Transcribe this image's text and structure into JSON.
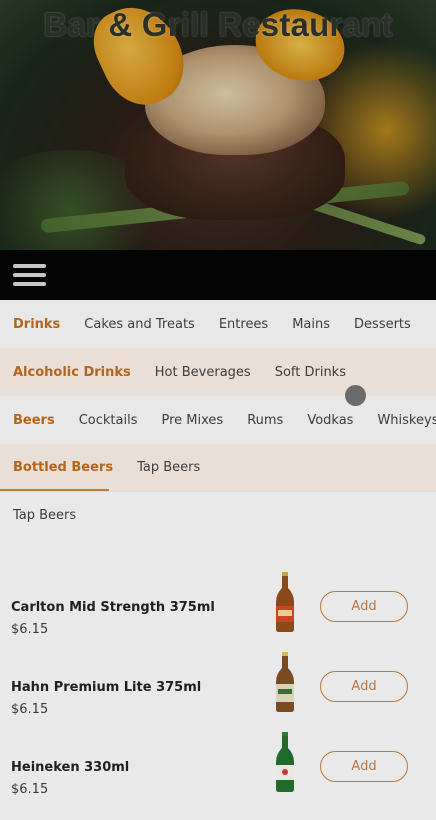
{
  "header": {
    "title": "Bar & Grill Restaurant",
    "menu_icon": "hamburger-menu-icon"
  },
  "nav": {
    "categories": [
      {
        "label": "Drinks",
        "active": true
      },
      {
        "label": "Cakes and Treats",
        "active": false
      },
      {
        "label": "Entrees",
        "active": false
      },
      {
        "label": "Mains",
        "active": false
      },
      {
        "label": "Desserts",
        "active": false
      }
    ],
    "subcategories": [
      {
        "label": "Alcoholic Drinks",
        "active": true
      },
      {
        "label": "Hot Beverages",
        "active": false
      },
      {
        "label": "Soft Drinks",
        "active": false
      }
    ],
    "types": [
      {
        "label": "Beers",
        "active": true
      },
      {
        "label": "Cocktails",
        "active": false
      },
      {
        "label": "Pre Mixes",
        "active": false
      },
      {
        "label": "Rums",
        "active": false
      },
      {
        "label": "Vodkas",
        "active": false
      },
      {
        "label": "Whiskeys",
        "active": false
      }
    ],
    "subtypes": [
      {
        "label": "Bottled Beers",
        "active": true
      },
      {
        "label": "Tap Beers",
        "active": false
      }
    ]
  },
  "section": {
    "title": "Tap Beers"
  },
  "products": [
    {
      "name": "Carlton Mid Strength 375ml",
      "price": "$6.15",
      "add_label": "Add",
      "bottle_color": "#8a4a1a",
      "label_color": "#c8442c"
    },
    {
      "name": "Hahn Premium Lite 375ml",
      "price": "$6.15",
      "add_label": "Add",
      "bottle_color": "#7a4a22",
      "label_color": "#d9d2b6"
    },
    {
      "name": "Heineken 330ml",
      "price": "$6.15",
      "add_label": "Add",
      "bottle_color": "#1f6b2c",
      "label_color": "#e8e8e0"
    }
  ],
  "colors": {
    "accent": "#b3651c",
    "navbar": "#040404"
  }
}
